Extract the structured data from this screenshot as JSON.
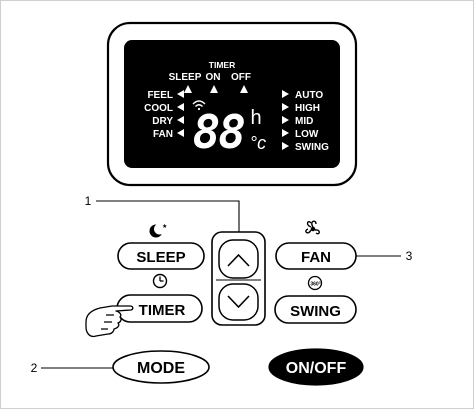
{
  "display": {
    "top": {
      "timer": "TIMER",
      "sleep": "SLEEP",
      "on": "ON",
      "off": "OFF"
    },
    "left": [
      "FEEL",
      "COOL",
      "DRY",
      "FAN"
    ],
    "right": [
      "AUTO",
      "HIGH",
      "MID",
      "LOW",
      "SWING"
    ],
    "digits": "88",
    "decimal": ".",
    "hour_unit": "h",
    "temp_unit": "°c"
  },
  "buttons": {
    "sleep": "SLEEP",
    "timer": "TIMER",
    "fan": "FAN",
    "swing": "SWING",
    "mode": "MODE",
    "onoff": "ON/OFF",
    "swing_icon_text": "360°"
  },
  "callouts": {
    "c1": "1",
    "c2": "2",
    "c3": "3"
  },
  "colors": {
    "panel": "#000000",
    "screen_text": "#ffffff",
    "line": "#000000"
  }
}
